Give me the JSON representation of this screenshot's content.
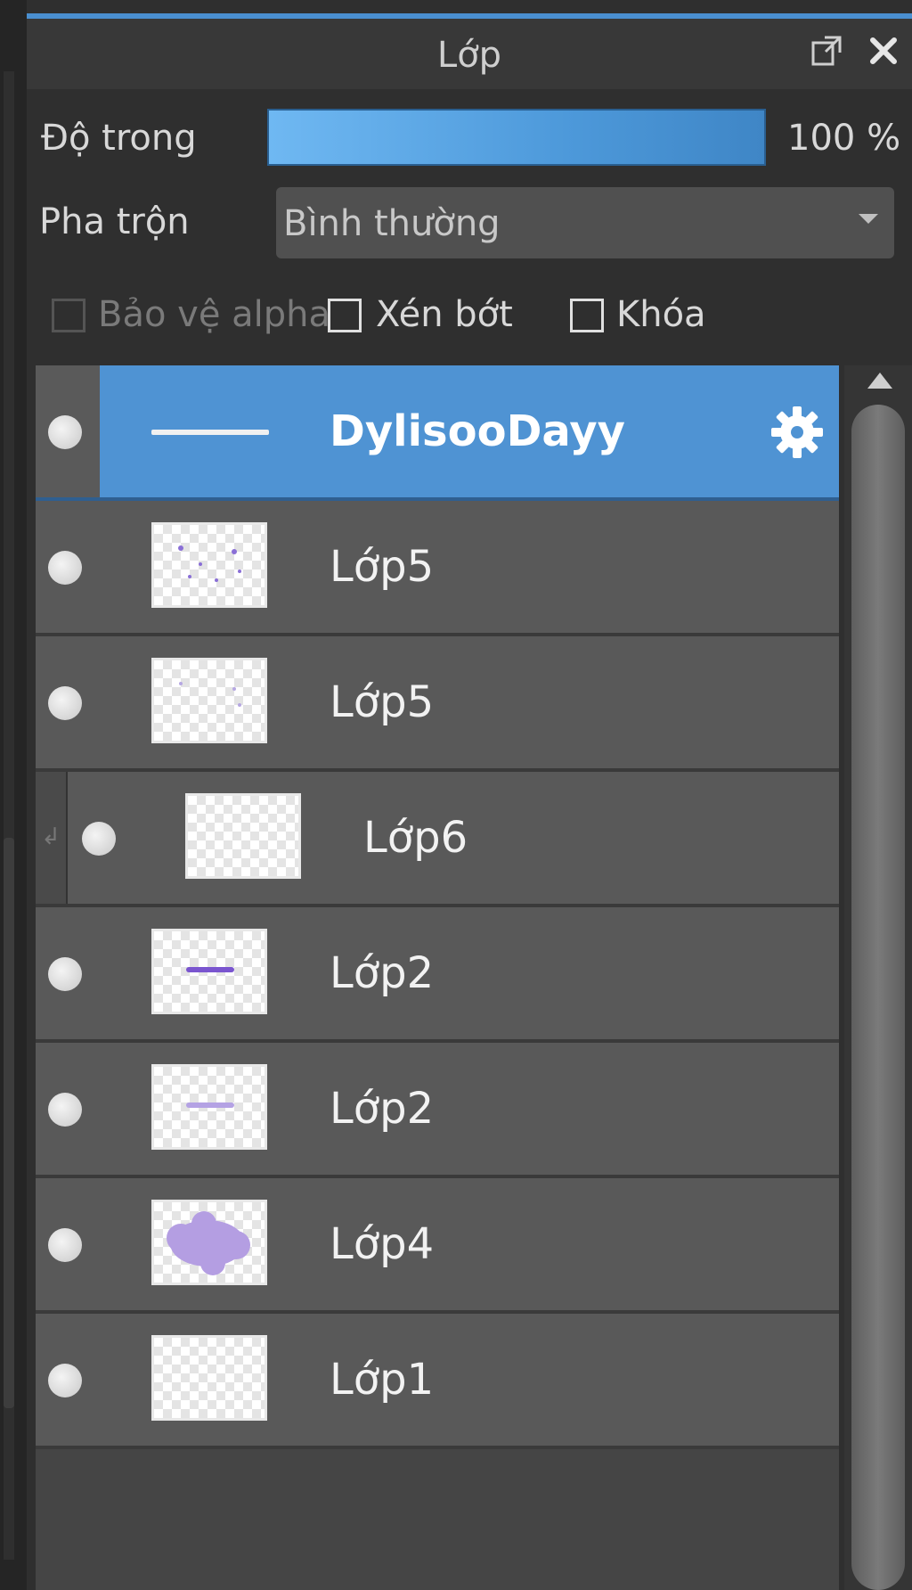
{
  "panel": {
    "title": "Lớp",
    "icons": {
      "popout": "popout-icon",
      "close": "close-icon"
    }
  },
  "opacity": {
    "label": "Độ trong",
    "value_text": "100 %",
    "level": 1.0
  },
  "blend": {
    "label": "Pha trộn",
    "selected": "Bình thường"
  },
  "options": {
    "protect_alpha": {
      "label": "Bảo vệ alpha",
      "checked": false,
      "disabled": true
    },
    "clipping": {
      "label": "Xén bớt",
      "checked": false
    },
    "lock": {
      "label": "Khóa",
      "checked": false
    }
  },
  "layers": [
    {
      "name": "DylisooDayy",
      "selected": true,
      "clipped": false,
      "thumb": "text-line"
    },
    {
      "name": "Lớp5",
      "selected": false,
      "clipped": false,
      "thumb": "dots"
    },
    {
      "name": "Lớp5",
      "selected": false,
      "clipped": false,
      "thumb": "faint-dots"
    },
    {
      "name": "Lớp6",
      "selected": false,
      "clipped": true,
      "thumb": "empty"
    },
    {
      "name": "Lớp2",
      "selected": false,
      "clipped": false,
      "thumb": "text-purple"
    },
    {
      "name": "Lớp2",
      "selected": false,
      "clipped": false,
      "thumb": "text-faint"
    },
    {
      "name": "Lớp4",
      "selected": false,
      "clipped": false,
      "thumb": "cloud"
    },
    {
      "name": "Lớp1",
      "selected": false,
      "clipped": false,
      "thumb": "empty"
    }
  ],
  "colors": {
    "accent": "#4f93d3",
    "row": "#595959",
    "thumb_ink": "#8a6fd6"
  }
}
